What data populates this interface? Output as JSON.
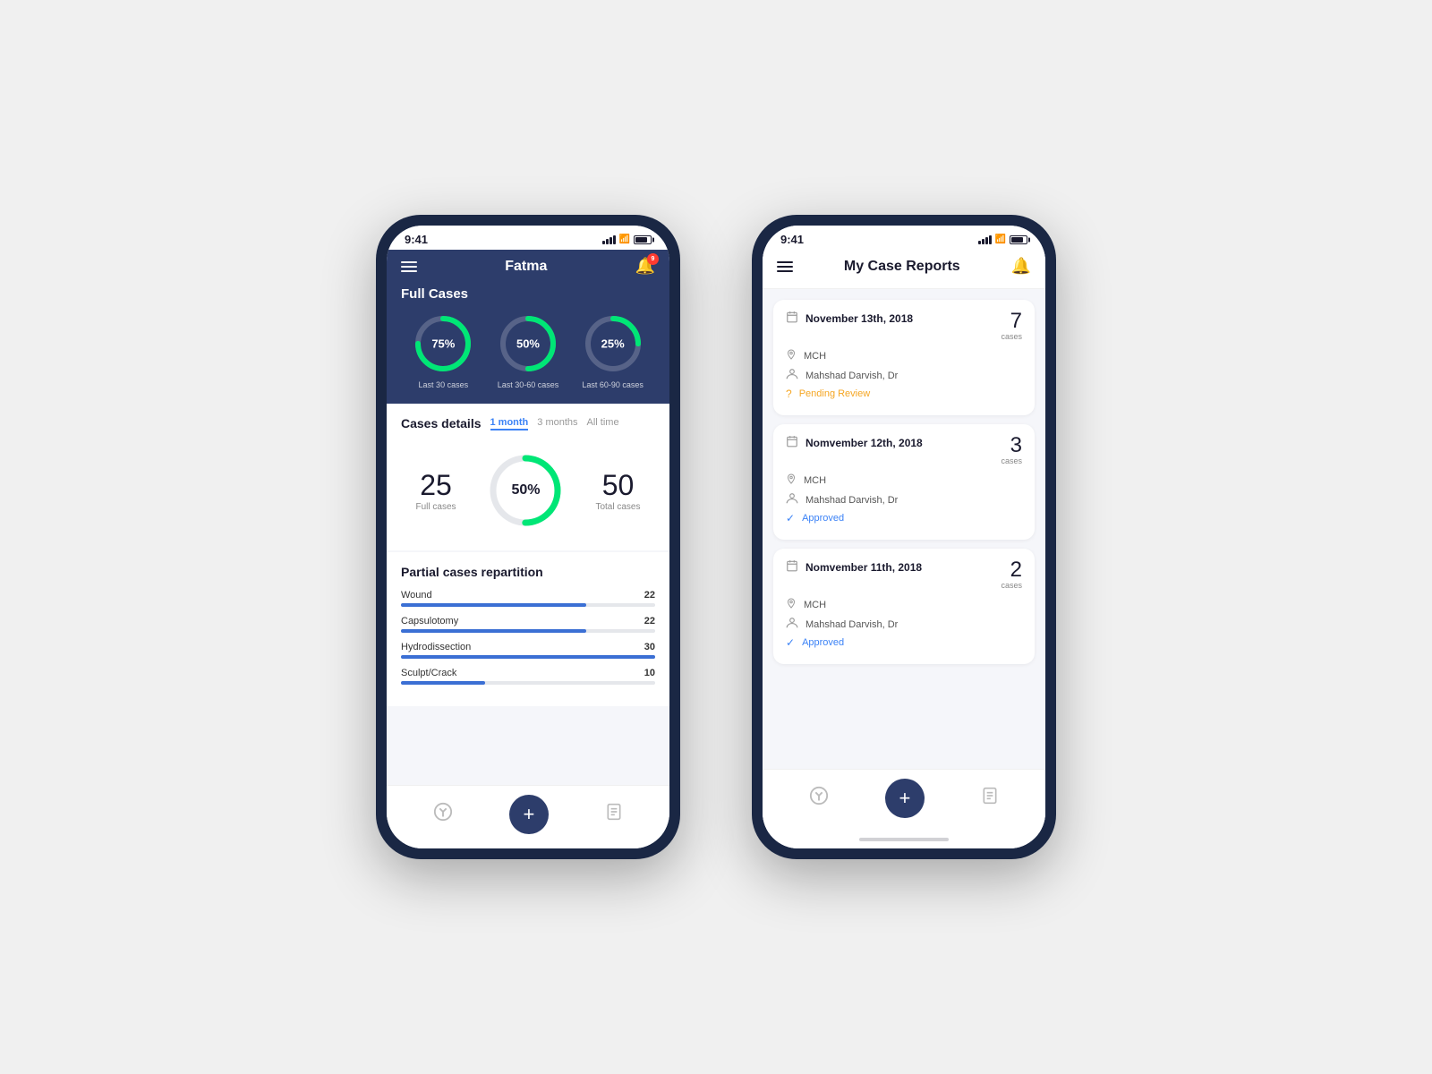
{
  "phone1": {
    "time": "9:41",
    "nav_title": "Fatma",
    "bell_badge": "9",
    "full_cases_title": "Full Cases",
    "circles": [
      {
        "percent": 75,
        "label": "Last 30 cases",
        "display": "75%"
      },
      {
        "percent": 50,
        "label": "Last 30-60 cases",
        "display": "50%"
      },
      {
        "percent": 25,
        "label": "Last 60-90 cases",
        "display": "25%"
      }
    ],
    "cases_details_title": "Cases details",
    "tabs": [
      {
        "label": "1 month",
        "active": true
      },
      {
        "label": "3 months",
        "active": false
      },
      {
        "label": "All time",
        "active": false
      }
    ],
    "full_cases_count": "25",
    "full_cases_label": "Full cases",
    "donut_percent": "50%",
    "total_cases_count": "50",
    "total_cases_label": "Total cases",
    "partial_title": "Partial cases repartition",
    "bars": [
      {
        "label": "Wound",
        "value": "22",
        "pct": 73
      },
      {
        "label": "Capsulotomy",
        "value": "22",
        "pct": 73
      },
      {
        "label": "Hydrodissection",
        "value": "30",
        "pct": 100
      },
      {
        "label": "Sculpt/Crack",
        "value": "10",
        "pct": 33
      }
    ],
    "bottom_nav": {
      "icon1": "⊙",
      "plus": "+",
      "icon3": "📄"
    }
  },
  "phone2": {
    "time": "9:41",
    "title": "My Case Reports",
    "cases": [
      {
        "date": "November 13th, 2018",
        "location": "MCH",
        "doctor": "Mahshad Darvish, Dr",
        "status": "Pending Review",
        "status_type": "pending",
        "count": "7",
        "count_label": "cases"
      },
      {
        "date": "Nomvember 12th, 2018",
        "location": "MCH",
        "doctor": "Mahshad Darvish, Dr",
        "status": "Approved",
        "status_type": "approved",
        "count": "3",
        "count_label": "cases"
      },
      {
        "date": "Nomvember 11th, 2018",
        "location": "MCH",
        "doctor": "Mahshad Darvish, Dr",
        "status": "Approved",
        "status_type": "approved",
        "count": "2",
        "count_label": "cases"
      }
    ],
    "bottom_nav": {
      "icon1": "⊙",
      "plus": "+",
      "icon3": "📄"
    }
  }
}
